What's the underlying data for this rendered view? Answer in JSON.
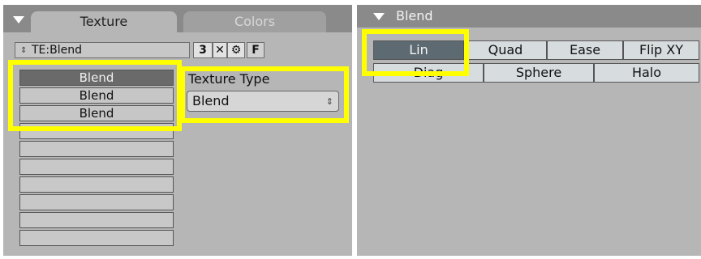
{
  "left": {
    "tabs": {
      "active": "Texture",
      "inactive": "Colors"
    },
    "texture_field": "TE:Blend",
    "user_count": "3",
    "fake_user": "F",
    "list": [
      "Blend",
      "Blend",
      "Blend"
    ],
    "texture_type_label": "Texture Type",
    "texture_type_value": "Blend"
  },
  "right": {
    "title": "Blend",
    "row1": [
      "Lin",
      "Quad",
      "Ease",
      "Flip XY"
    ],
    "row2": [
      "Diag",
      "Sphere",
      "Halo"
    ]
  },
  "colors": {
    "highlight": "#ffff00",
    "panel_bg": "#b6b6b6",
    "active_button": "#5d6a72"
  }
}
